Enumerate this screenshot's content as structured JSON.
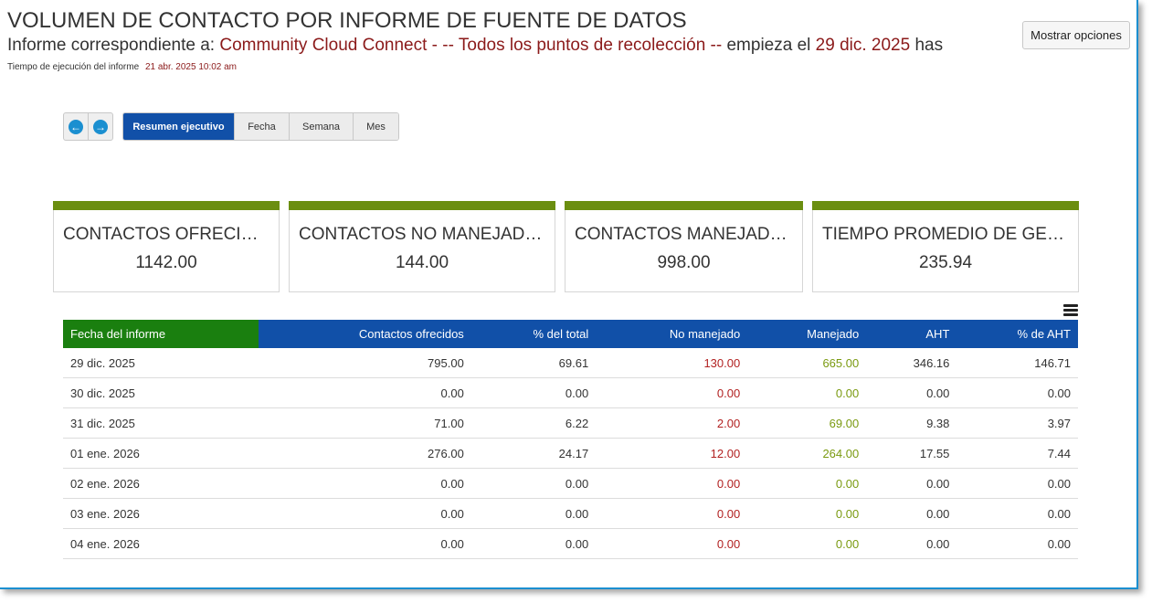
{
  "header": {
    "title": "VOLUMEN DE CONTACTO POR INFORME DE FUENTE DE DATOS",
    "subtitle_prefix": "Informe correspondiente a:",
    "subtitle_source": "Community Cloud Connect  - -- Todos los puntos de recolección --",
    "subtitle_mid": "empieza el",
    "subtitle_date": "29 dic. 2025",
    "subtitle_tail": "has",
    "exec_label": "Tiempo de ejecución del informe",
    "exec_value": "21 abr. 2025 10:02 am",
    "options_button": "Mostrar opciones"
  },
  "nav": {
    "prev_icon": "arrow-left-icon",
    "next_icon": "arrow-right-icon",
    "tabs": [
      "Resumen ejecutivo",
      "Fecha",
      "Semana",
      "Mes"
    ],
    "active_tab": "Resumen ejecutivo"
  },
  "kpis": [
    {
      "label": "CONTACTOS OFRECIDOS",
      "value": "1142.00"
    },
    {
      "label": "CONTACTOS NO MANEJADOS",
      "value": "144.00"
    },
    {
      "label": "CONTACTOS MANEJADOS",
      "value": "998.00"
    },
    {
      "label": "TIEMPO PROMEDIO DE GESTIÓN",
      "value": "235.94"
    }
  ],
  "table": {
    "menu_icon": "hamburger-menu-icon",
    "columns": [
      "Fecha del informe",
      "Contactos ofrecidos",
      "% del total",
      "No manejado",
      "Manejado",
      "AHT",
      "% de AHT"
    ],
    "rows": [
      [
        "29 dic. 2025",
        "795.00",
        "69.61",
        "130.00",
        "665.00",
        "346.16",
        "146.71"
      ],
      [
        "30 dic. 2025",
        "0.00",
        "0.00",
        "0.00",
        "0.00",
        "0.00",
        "0.00"
      ],
      [
        "31 dic. 2025",
        "71.00",
        "6.22",
        "2.00",
        "69.00",
        "9.38",
        "3.97"
      ],
      [
        "01 ene. 2026",
        "276.00",
        "24.17",
        "12.00",
        "264.00",
        "17.55",
        "7.44"
      ],
      [
        "02 ene. 2026",
        "0.00",
        "0.00",
        "0.00",
        "0.00",
        "0.00",
        "0.00"
      ],
      [
        "03 ene. 2026",
        "0.00",
        "0.00",
        "0.00",
        "0.00",
        "0.00",
        "0.00"
      ],
      [
        "04 ene. 2026",
        "0.00",
        "0.00",
        "0.00",
        "0.00",
        "0.00",
        "0.00"
      ]
    ]
  },
  "colors": {
    "header_blue": "#1150a8",
    "header_green": "#1a7f0f",
    "kpi_bar": "#6b8e10",
    "unhandled": "#b22222",
    "handled": "#7a9a10",
    "highlight_text": "#8b1a1a"
  }
}
